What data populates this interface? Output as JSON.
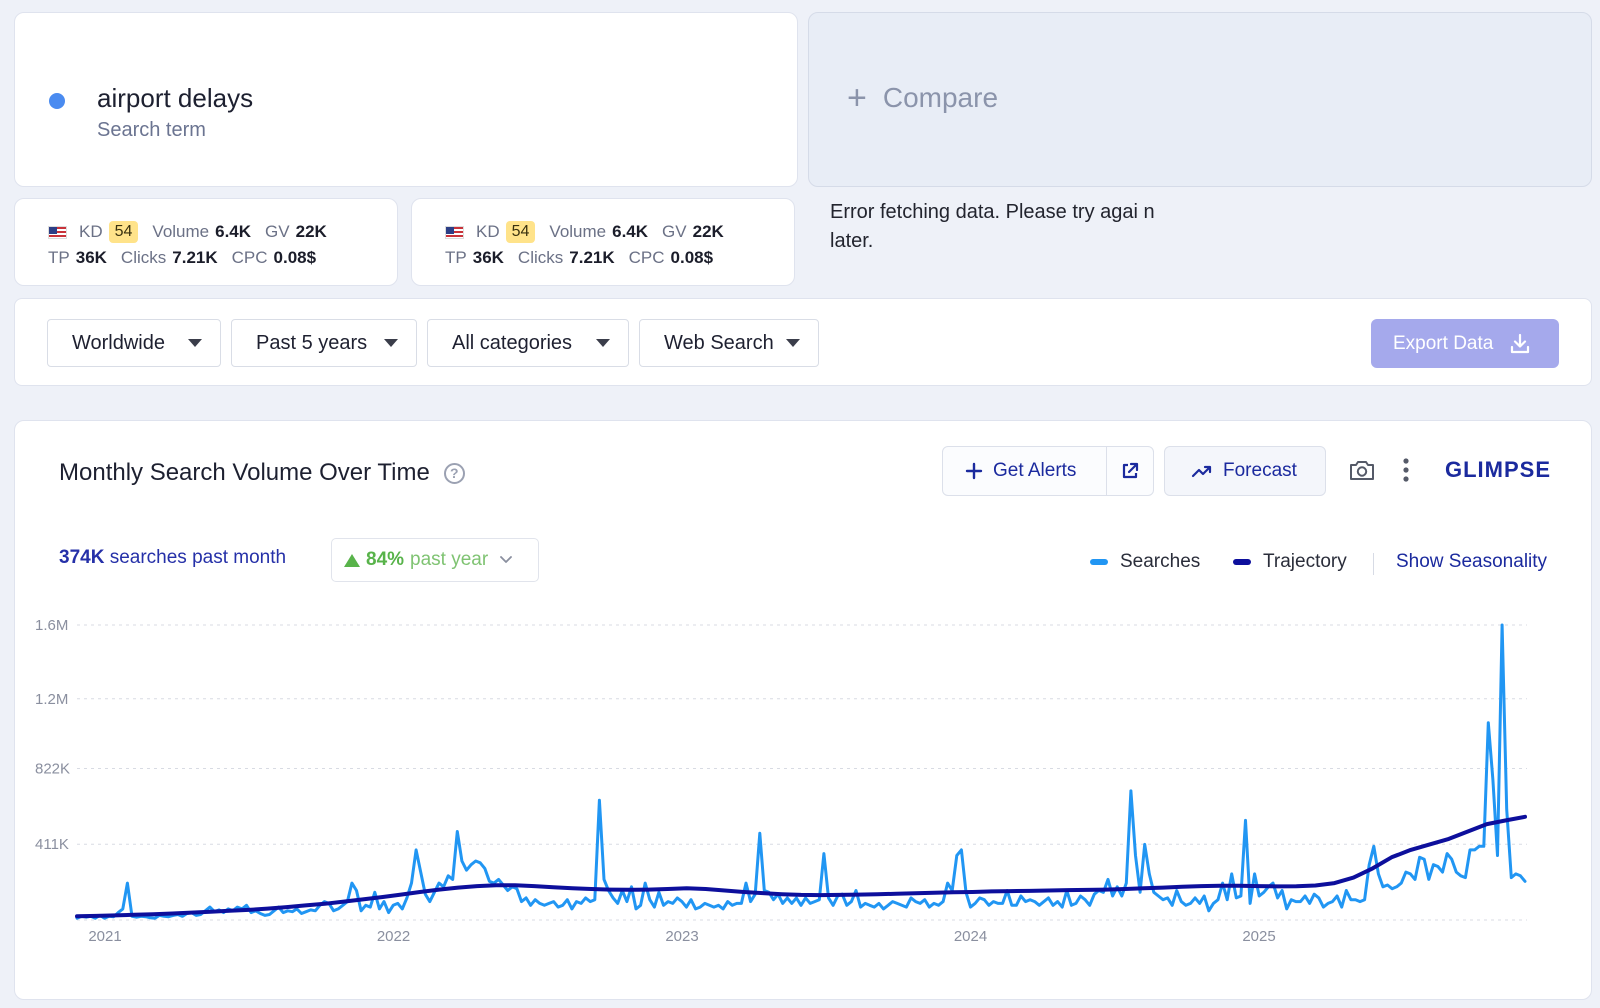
{
  "term": {
    "name": "airport delays",
    "subtitle": "Search term"
  },
  "compare": {
    "label": "Compare"
  },
  "metrics": [
    {
      "kd_label": "KD",
      "kd": "54",
      "volume_label": "Volume",
      "volume": "6.4K",
      "gv_label": "GV",
      "gv": "22K",
      "tp_label": "TP",
      "tp": "36K",
      "clicks_label": "Clicks",
      "clicks": "7.21K",
      "cpc_label": "CPC",
      "cpc": "0.08$"
    },
    {
      "kd_label": "KD",
      "kd": "54",
      "volume_label": "Volume",
      "volume": "6.4K",
      "gv_label": "GV",
      "gv": "22K",
      "tp_label": "TP",
      "tp": "36K",
      "clicks_label": "Clicks",
      "clicks": "7.21K",
      "cpc_label": "CPC",
      "cpc": "0.08$"
    }
  ],
  "error_message": "Error fetching data. Please try agai n later.",
  "filters": {
    "region": "Worldwide",
    "period": "Past 5 years",
    "category": "All categories",
    "source": "Web Search"
  },
  "export_label": "Export Data",
  "chart_panel": {
    "title": "Monthly Search Volume Over Time",
    "get_alerts": "Get Alerts",
    "forecast": "Forecast",
    "brand": "GLIMPSE",
    "searches_value": "374K",
    "searches_text": "searches past month",
    "trend_value": "84%",
    "trend_text": "past year",
    "legend_searches": "Searches",
    "legend_trajectory": "Trajectory",
    "show_seasonality": "Show Seasonality",
    "colors": {
      "searches": "#2196f3",
      "trajectory": "#0d0f9c",
      "accent": "#1b2a9e",
      "export_button": "#a5a9ec",
      "positive": "#58b34a"
    }
  },
  "chart_data": {
    "type": "line",
    "x_labels": [
      "2021",
      "2022",
      "2023",
      "2024",
      "2025"
    ],
    "y_ticks": [
      "411K",
      "822K",
      "1.2M",
      "1.6M"
    ],
    "ylim": [
      0,
      1600000
    ],
    "grid": true,
    "series": [
      {
        "name": "Searches",
        "values": [
          10000,
          20000,
          15000,
          20000,
          10000,
          25000,
          10000,
          20000,
          18000,
          40000,
          60000,
          200000,
          20000,
          15000,
          20000,
          18000,
          12000,
          10000,
          25000,
          20000,
          18000,
          25000,
          30000,
          20000,
          35000,
          40000,
          25000,
          30000,
          50000,
          70000,
          45000,
          55000,
          40000,
          60000,
          50000,
          70000,
          60000,
          80000,
          40000,
          50000,
          35000,
          25000,
          30000,
          50000,
          70000,
          40000,
          50000,
          45000,
          60000,
          35000,
          45000,
          55000,
          50000,
          80000,
          100000,
          90000,
          50000,
          60000,
          80000,
          100000,
          200000,
          160000,
          50000,
          80000,
          70000,
          150000,
          60000,
          100000,
          40000,
          80000,
          90000,
          60000,
          120000,
          200000,
          380000,
          260000,
          140000,
          100000,
          150000,
          200000,
          180000,
          240000,
          220000,
          480000,
          320000,
          270000,
          300000,
          320000,
          310000,
          280000,
          210000,
          200000,
          220000,
          190000,
          160000,
          180000,
          170000,
          100000,
          120000,
          80000,
          110000,
          90000,
          80000,
          90000,
          100000,
          70000,
          80000,
          110000,
          60000,
          100000,
          90000,
          120000,
          100000,
          110000,
          650000,
          220000,
          160000,
          120000,
          90000,
          160000,
          100000,
          180000,
          60000,
          80000,
          200000,
          110000,
          70000,
          150000,
          80000,
          100000,
          90000,
          120000,
          100000,
          70000,
          110000,
          60000,
          70000,
          90000,
          80000,
          70000,
          80000,
          60000,
          100000,
          80000,
          90000,
          90000,
          200000,
          100000,
          140000,
          470000,
          160000,
          150000,
          110000,
          140000,
          90000,
          120000,
          90000,
          120000,
          80000,
          120000,
          90000,
          100000,
          110000,
          360000,
          120000,
          80000,
          130000,
          140000,
          80000,
          100000,
          160000,
          70000,
          90000,
          80000,
          70000,
          90000,
          60000,
          80000,
          100000,
          90000,
          80000,
          70000,
          120000,
          100000,
          90000,
          110000,
          70000,
          90000,
          80000,
          100000,
          200000,
          160000,
          350000,
          380000,
          150000,
          70000,
          90000,
          120000,
          110000,
          80000,
          100000,
          90000,
          90000,
          160000,
          80000,
          80000,
          130000,
          100000,
          110000,
          100000,
          80000,
          100000,
          120000,
          80000,
          100000,
          70000,
          160000,
          80000,
          90000,
          130000,
          110000,
          80000,
          140000,
          160000,
          150000,
          220000,
          130000,
          180000,
          130000,
          200000,
          700000,
          350000,
          150000,
          410000,
          250000,
          150000,
          130000,
          110000,
          120000,
          80000,
          160000,
          100000,
          80000,
          90000,
          120000,
          90000,
          130000,
          50000,
          90000,
          110000,
          200000,
          110000,
          250000,
          120000,
          130000,
          540000,
          90000,
          250000,
          130000,
          150000,
          180000,
          200000,
          120000,
          160000,
          60000,
          110000,
          100000,
          100000,
          130000,
          90000,
          140000,
          120000,
          70000,
          90000,
          100000,
          130000,
          70000,
          160000,
          110000,
          110000,
          100000,
          110000,
          300000,
          400000,
          250000,
          180000,
          190000,
          170000,
          180000,
          200000,
          260000,
          250000,
          220000,
          340000,
          330000,
          220000,
          300000,
          290000,
          260000,
          360000,
          330000,
          260000,
          240000,
          230000,
          380000,
          380000,
          400000,
          400000,
          1070000,
          760000,
          350000,
          1600000,
          600000,
          230000,
          250000,
          240000,
          210000
        ]
      },
      {
        "name": "Trajectory",
        "values": [
          20000,
          22000,
          25000,
          28000,
          31000,
          35000,
          40000,
          45000,
          50000,
          55000,
          62000,
          70000,
          79000,
          88000,
          100000,
          112000,
          124000,
          138000,
          152000,
          165000,
          176000,
          184000,
          188000,
          188000,
          184000,
          178000,
          172000,
          168000,
          165000,
          164000,
          165000,
          168000,
          172000,
          168000,
          160000,
          152000,
          146000,
          140000,
          136000,
          135000,
          136000,
          138000,
          140000,
          142000,
          145000,
          148000,
          150000,
          152000,
          155000,
          157000,
          158000,
          160000,
          162000,
          163000,
          165000,
          168000,
          172000,
          176000,
          180000,
          184000,
          186000,
          186000,
          184000,
          182000,
          183000,
          187000,
          200000,
          230000,
          280000,
          340000,
          380000,
          410000,
          440000,
          480000,
          520000,
          540000,
          560000
        ]
      }
    ]
  }
}
